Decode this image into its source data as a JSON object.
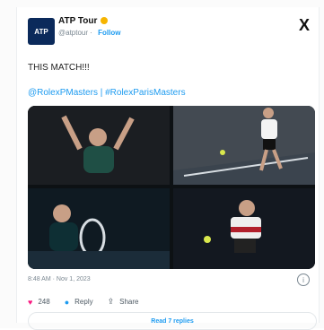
{
  "account": {
    "name": "ATP Tour",
    "handle": "@atptour",
    "follow_label": "Follow",
    "avatar_text": "ATP"
  },
  "tweet": {
    "text": "THIS MATCH!!!",
    "hashtags": "@RolexPMasters | #RolexParisMasters",
    "timestamp": "8:48 AM · Nov 1, 2023",
    "likes": "248",
    "reply_label": "Reply",
    "share_label": "Share",
    "read_replies_label": "Read 7 replies"
  },
  "header": {
    "platform_logo": "X"
  },
  "colors": {
    "accent": "#1d9bf0",
    "like": "#f91880",
    "brand": "#0b2a5b"
  }
}
